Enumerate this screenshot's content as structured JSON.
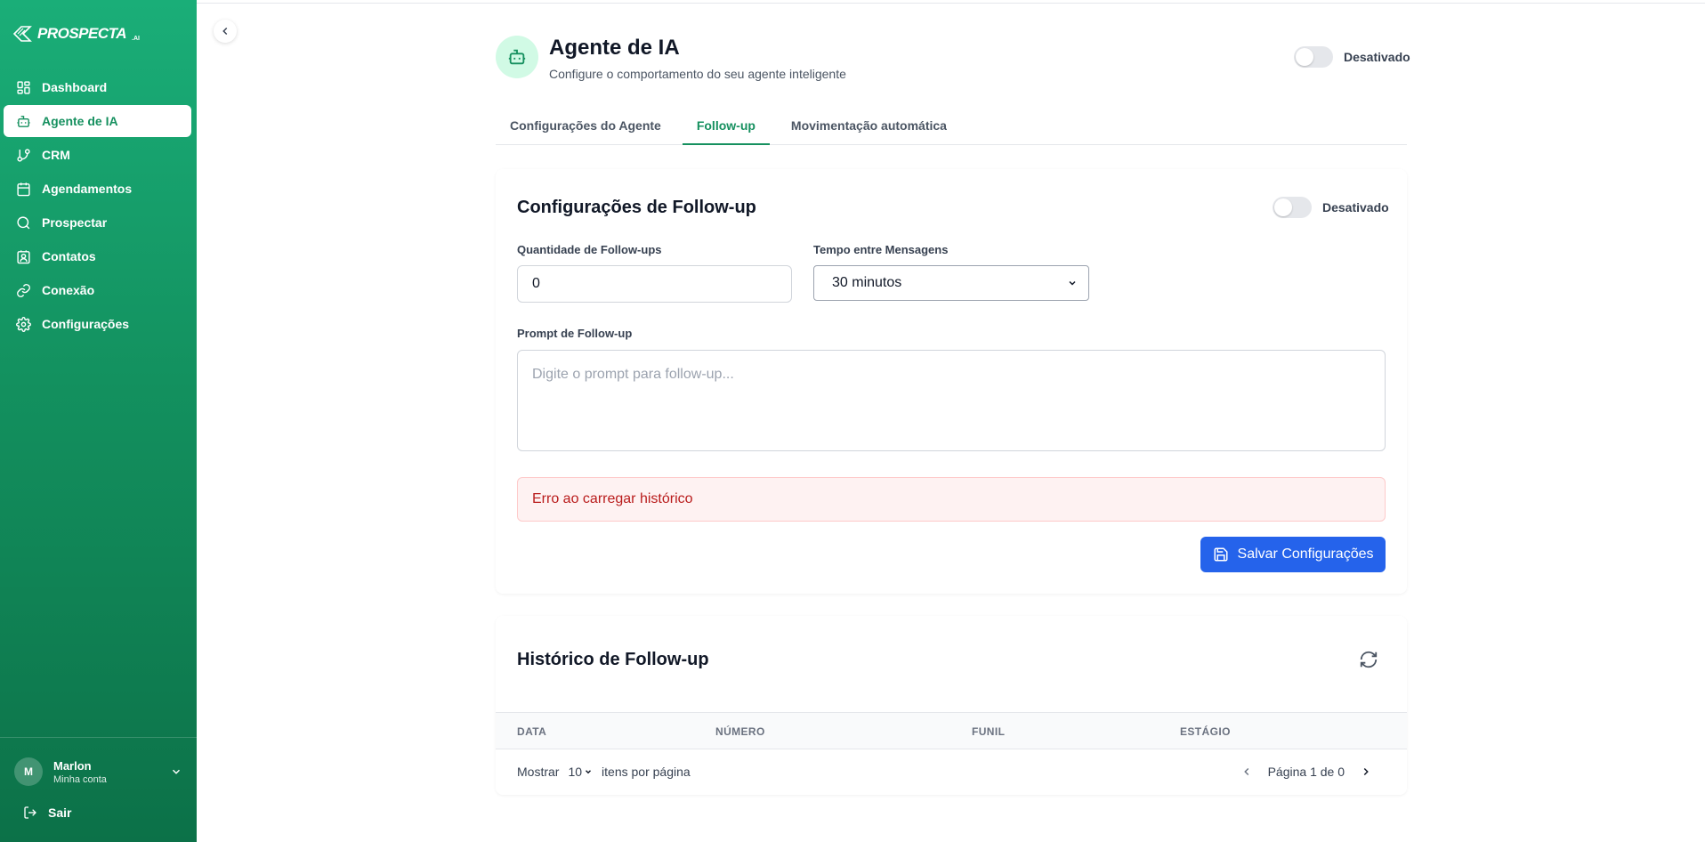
{
  "brand": {
    "name": "PROSPECTA",
    "suffix": ".AI"
  },
  "sidebar": {
    "items": [
      {
        "label": "Dashboard",
        "icon": "dashboard-icon"
      },
      {
        "label": "Agente de IA",
        "icon": "bot-icon",
        "active": true
      },
      {
        "label": "CRM",
        "icon": "git-branch-icon"
      },
      {
        "label": "Agendamentos",
        "icon": "calendar-icon"
      },
      {
        "label": "Prospectar",
        "icon": "search-icon"
      },
      {
        "label": "Contatos",
        "icon": "contact-icon"
      },
      {
        "label": "Conexão",
        "icon": "link-icon"
      },
      {
        "label": "Configurações",
        "icon": "gear-icon"
      }
    ],
    "user": {
      "initial": "M",
      "name": "Marlon",
      "subtitle": "Minha conta"
    },
    "logout_label": "Sair"
  },
  "header": {
    "title": "Agente de IA",
    "subtitle": "Configure o comportamento do seu agente inteligente",
    "toggle_label": "Desativado"
  },
  "tabs": [
    {
      "label": "Configurações do Agente"
    },
    {
      "label": "Follow-up",
      "active": true
    },
    {
      "label": "Movimentação automática"
    }
  ],
  "followup": {
    "title": "Configurações de Follow-up",
    "toggle_label": "Desativado",
    "quantity_label": "Quantidade de Follow-ups",
    "quantity_value": "0",
    "interval_label": "Tempo entre Mensagens",
    "interval_value": "30 minutos",
    "prompt_label": "Prompt de Follow-up",
    "prompt_placeholder": "Digite o prompt para follow-up...",
    "error_text": "Erro ao carregar histórico",
    "save_label": "Salvar Configurações"
  },
  "history": {
    "title": "Histórico de Follow-up",
    "columns": [
      "DATA",
      "NÚMERO",
      "FUNIL",
      "ESTÁGIO"
    ],
    "show_label": "Mostrar",
    "page_size": "10",
    "per_page_label": "itens por página",
    "page_info": "Página 1 de 0"
  },
  "colors": {
    "brand_green": "#16905f",
    "primary_blue": "#2563eb",
    "error_red": "#b91c1c"
  }
}
